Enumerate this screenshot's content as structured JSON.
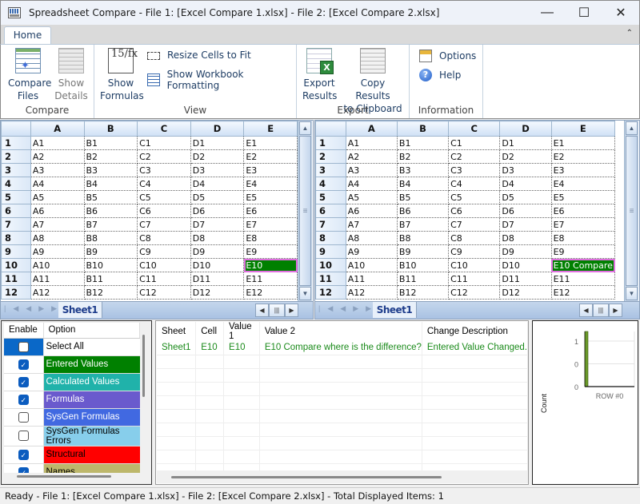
{
  "window": {
    "title": "Spreadsheet Compare - File 1: [Excel Compare 1.xlsx] - File 2: [Excel Compare 2.xlsx]",
    "icon": "spreadsheet-compare-app-icon",
    "controls": {
      "minimize": "—",
      "maximize": "☐",
      "close": "✕"
    }
  },
  "ribbon": {
    "tabs": [
      {
        "label": "Home",
        "active": true
      }
    ],
    "collapse_icon": "⌃",
    "groups": {
      "compare": {
        "label": "Compare",
        "compare_files": {
          "label1": "Compare",
          "label2": "Files",
          "icon": "compare-files-icon"
        },
        "show_details": {
          "label1": "Show",
          "label2": "Details",
          "icon": "show-details-icon",
          "enabled": false
        }
      },
      "view": {
        "label": "View",
        "show_formulas": {
          "label1": "Show",
          "label2": "Formulas",
          "icon": "formula-icon",
          "glyph": "15/fx"
        },
        "resize_cells": {
          "label": "Resize Cells to Fit",
          "icon": "resize-cells-icon"
        },
        "show_formatting": {
          "label": "Show Workbook Formatting",
          "icon": "workbook-formatting-icon"
        }
      },
      "export": {
        "label": "Export",
        "export_results": {
          "label1": "Export",
          "label2": "Results",
          "icon": "export-excel-icon"
        },
        "copy_results": {
          "label1": "Copy Results",
          "label2": "to Clipboard",
          "icon": "copy-clipboard-icon"
        }
      },
      "information": {
        "label": "Information",
        "options": {
          "label": "Options",
          "icon": "options-icon"
        },
        "help": {
          "label": "Help",
          "icon": "help-icon",
          "glyph": "?"
        }
      }
    }
  },
  "sheets": {
    "columns": [
      "A",
      "B",
      "C",
      "D",
      "E"
    ],
    "left": {
      "sheet_tab": "Sheet1",
      "rows": [
        [
          "1",
          "A1",
          "B1",
          "C1",
          "D1",
          "E1"
        ],
        [
          "2",
          "A2",
          "B2",
          "C2",
          "D2",
          "E2"
        ],
        [
          "3",
          "A3",
          "B3",
          "C3",
          "D3",
          "E3"
        ],
        [
          "4",
          "A4",
          "B4",
          "C4",
          "D4",
          "E4"
        ],
        [
          "5",
          "A5",
          "B5",
          "C5",
          "D5",
          "E5"
        ],
        [
          "6",
          "A6",
          "B6",
          "C6",
          "D6",
          "E6"
        ],
        [
          "7",
          "A7",
          "B7",
          "C7",
          "D7",
          "E7"
        ],
        [
          "8",
          "A8",
          "B8",
          "C8",
          "D8",
          "E8"
        ],
        [
          "9",
          "A9",
          "B9",
          "C9",
          "D9",
          "E9"
        ],
        [
          "10",
          "A10",
          "B10",
          "C10",
          "D10",
          "E10"
        ],
        [
          "11",
          "A11",
          "B11",
          "C11",
          "D11",
          "E11"
        ],
        [
          "12",
          "A12",
          "B12",
          "C12",
          "D12",
          "E12"
        ]
      ],
      "highlight": {
        "row": 10,
        "col": "E",
        "color": "#008000",
        "border": "#e070e0"
      }
    },
    "right": {
      "sheet_tab": "Sheet1",
      "rows": [
        [
          "1",
          "A1",
          "B1",
          "C1",
          "D1",
          "E1"
        ],
        [
          "2",
          "A2",
          "B2",
          "C2",
          "D2",
          "E2"
        ],
        [
          "3",
          "A3",
          "B3",
          "C3",
          "D3",
          "E3"
        ],
        [
          "4",
          "A4",
          "B4",
          "C4",
          "D4",
          "E4"
        ],
        [
          "5",
          "A5",
          "B5",
          "C5",
          "D5",
          "E5"
        ],
        [
          "6",
          "A6",
          "B6",
          "C6",
          "D6",
          "E6"
        ],
        [
          "7",
          "A7",
          "B7",
          "C7",
          "D7",
          "E7"
        ],
        [
          "8",
          "A8",
          "B8",
          "C8",
          "D8",
          "E8"
        ],
        [
          "9",
          "A9",
          "B9",
          "C9",
          "D9",
          "E9"
        ],
        [
          "10",
          "A10",
          "B10",
          "C10",
          "D10",
          "E10 Compare"
        ],
        [
          "11",
          "A11",
          "B11",
          "C11",
          "D11",
          "E11"
        ],
        [
          "12",
          "A12",
          "B12",
          "C12",
          "D12",
          "E12"
        ]
      ],
      "highlight": {
        "row": 10,
        "col": "E",
        "color": "#008000",
        "border": "#e070e0"
      }
    },
    "nav": {
      "first": "|◀",
      "prev": "◀",
      "next": "▶",
      "last": "▶|"
    },
    "scroll": {
      "up": "▲",
      "down": "▼",
      "left": "◀",
      "right": "▶",
      "grip": "≡",
      "hgrip": "|||"
    }
  },
  "options_panel": {
    "headers": {
      "enable": "Enable",
      "option": "Option"
    },
    "items": [
      {
        "label": "Select All",
        "checked": false,
        "color": "#ffffff",
        "text_color": "#000000",
        "selected": true
      },
      {
        "label": "Entered Values",
        "checked": true,
        "color": "#008000",
        "text_color": "#ffffff"
      },
      {
        "label": "Calculated Values",
        "checked": true,
        "color": "#20b2aa",
        "text_color": "#ffffff"
      },
      {
        "label": "Formulas",
        "checked": true,
        "color": "#6a5acd",
        "text_color": "#ffffff"
      },
      {
        "label": "SysGen Formulas",
        "checked": false,
        "color": "#4169e1",
        "text_color": "#ffffff"
      },
      {
        "label": "SysGen Formulas Errors",
        "checked": false,
        "color": "#87ceeb",
        "text_color": "#000000"
      },
      {
        "label": "Structural",
        "checked": true,
        "color": "#ff0000",
        "text_color": "#000000"
      },
      {
        "label": "Names",
        "checked": true,
        "color": "#bdb76b",
        "text_color": "#000000"
      }
    ]
  },
  "results": {
    "headers": [
      "Sheet",
      "Cell",
      "Value 1",
      "Value 2",
      "Change Description"
    ],
    "rows": [
      [
        "Sheet1",
        "E10",
        "E10",
        "E10 Compare where is the difference?",
        "Entered Value Changed."
      ]
    ],
    "row_color": "#1a8a1a"
  },
  "chart_data": {
    "type": "bar",
    "categories": [
      "ROW #0"
    ],
    "values": [
      1
    ],
    "ylabel": "Count",
    "xlabel": "",
    "ytick_labels": [
      "0",
      "0",
      "1"
    ],
    "ylim": [
      0,
      1
    ],
    "bar_color": "#6b9a2a",
    "grid": true
  },
  "status": {
    "text": "Ready - File 1: [Excel Compare 1.xlsx] - File 2: [Excel Compare 2.xlsx] - Total Displayed Items: 1"
  }
}
